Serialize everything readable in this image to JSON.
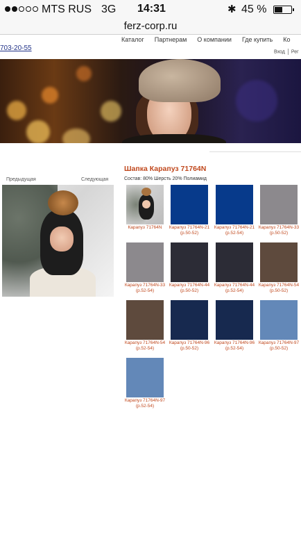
{
  "status_bar": {
    "signal_dots_filled": 2,
    "signal_dots_total": 5,
    "carrier": "MTS RUS",
    "network": "3G",
    "time": "14:31",
    "bluetooth_icon": "bluetooth-icon",
    "battery_percent": "45 %",
    "battery_level": 0.45
  },
  "browser": {
    "url": "ferz-corp.ru"
  },
  "site": {
    "phone": "703-20-55",
    "nav": [
      "Каталог",
      "Партнерам",
      "О компании",
      "Где купить",
      "Ко"
    ],
    "login": "Вход",
    "register": "Рег"
  },
  "product": {
    "title": "Шапка Карапуз 71764N",
    "composition": "Состав: 80% Шерсть 20% Полиамид",
    "prev": "Предыдущая",
    "next": "Следующая"
  },
  "variants": [
    {
      "label": "Карапуз 71764N",
      "color": "photo"
    },
    {
      "label": "Карапуз 71764N-21 (р.50-52)",
      "color": "#073a8b"
    },
    {
      "label": "Карапуз 71764N-21 (р.52-54)",
      "color": "#073a8b"
    },
    {
      "label": "Карапуз 71764N-33 (р.50-52)",
      "color": "#8c898d"
    },
    {
      "label": "Карапуз 71764N-33 (р.52-54)",
      "color": "#8c898d"
    },
    {
      "label": "Карапуз 71764N-44 (р.50-52)",
      "color": "#2c2c36"
    },
    {
      "label": "Карапуз 71764N-44 (р.52-54)",
      "color": "#2c2c36"
    },
    {
      "label": "Карапуз 71764N-54 (р.50-52)",
      "color": "#5e4a3d"
    },
    {
      "label": "Карапуз 71764N-54 (р.52-54)",
      "color": "#5e4a3d"
    },
    {
      "label": "Карапуз 71764N-96 (р.50-52)",
      "color": "#17294f"
    },
    {
      "label": "Карапуз 71764N-96 (р.52-54)",
      "color": "#17294f"
    },
    {
      "label": "Карапуз 71764N-97 (р.50-52)",
      "color": "#6388b8"
    },
    {
      "label": "Карапуз 71764N-97 (р.52-54)",
      "color": "#6388b8"
    }
  ]
}
